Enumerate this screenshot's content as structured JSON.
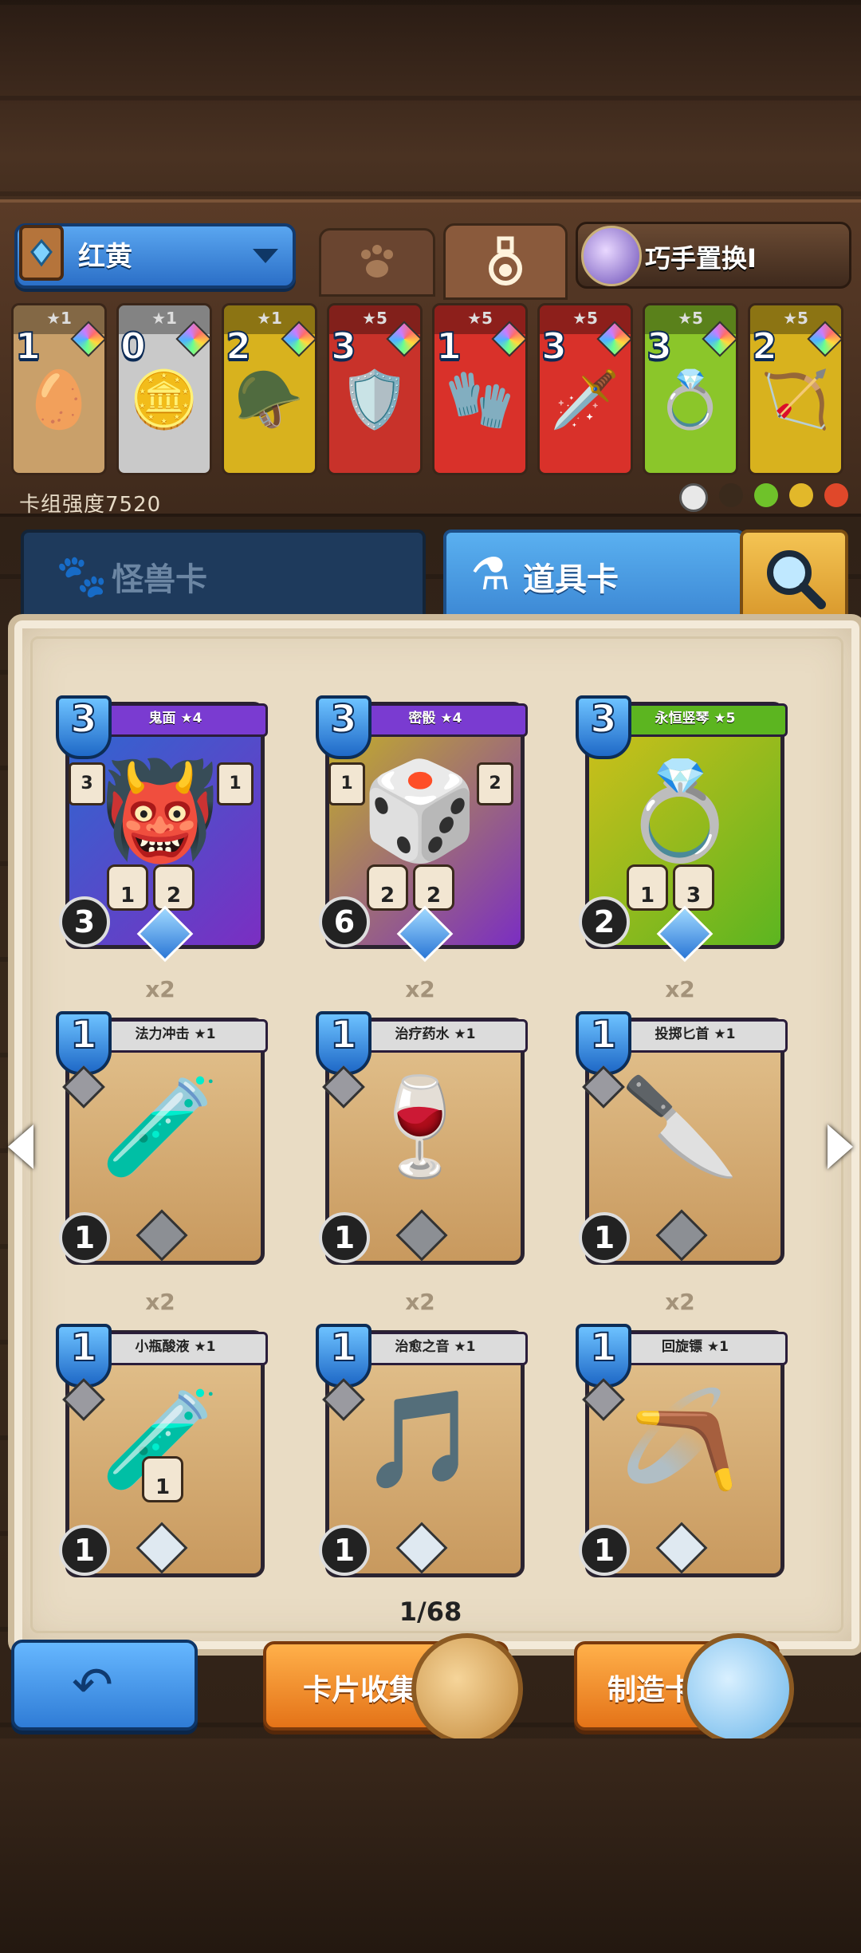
{
  "deck": {
    "name": "红黄",
    "swap_label": "巧手置换I",
    "power_label": "卡组强度7520"
  },
  "mini_cards": [
    {
      "stars": "★1",
      "cost": "1",
      "color": "#c9a06a",
      "art": "🥚"
    },
    {
      "stars": "★1",
      "cost": "0",
      "color": "#c9c9c9",
      "art": "🪙"
    },
    {
      "stars": "★1",
      "cost": "2",
      "color": "#d8b21e",
      "art": "🪖"
    },
    {
      "stars": "★5",
      "cost": "3",
      "color": "#c8322a",
      "art": "🛡️"
    },
    {
      "stars": "★5",
      "cost": "1",
      "color": "#d9312a",
      "art": "🧤"
    },
    {
      "stars": "★5",
      "cost": "3",
      "color": "#d9312a",
      "art": "🗡️"
    },
    {
      "stars": "★5",
      "cost": "3",
      "color": "#8bc62a",
      "art": "💍"
    },
    {
      "stars": "★5",
      "cost": "2",
      "color": "#d8b21e",
      "art": "🏹"
    }
  ],
  "tabs": {
    "monster": "怪兽卡",
    "item": "道具卡"
  },
  "cards_row1": [
    {
      "name": "鬼面 ★4",
      "cost": "3",
      "left": "3",
      "right": "1",
      "b1": "1",
      "b2": "2",
      "power": "3",
      "bg": "linear-gradient(135deg,#2a6ad1,#7b2ec2)",
      "banner": "#7a3bd1",
      "art": "👹"
    },
    {
      "name": "密骰 ★4",
      "cost": "3",
      "left": "1",
      "right": "2",
      "b1": "2",
      "b2": "2",
      "power": "6",
      "bg": "linear-gradient(135deg,#c8b71e,#7b2ec2)",
      "banner": "#7a3bd1",
      "art": "🎲"
    },
    {
      "name": "永恒竖琴 ★5",
      "cost": "3",
      "left": "",
      "right": "",
      "b1": "1",
      "b2": "3",
      "power": "2",
      "bg": "linear-gradient(135deg,#d4c01a,#5cb520)",
      "banner": "#5cb520",
      "art": "💍"
    }
  ],
  "cards_row2": [
    {
      "name": "法力冲击 ★1",
      "count": "x2",
      "cost": "1",
      "power": "1",
      "art": "🧪"
    },
    {
      "name": "治疗药水 ★1",
      "count": "x2",
      "cost": "1",
      "power": "1",
      "art": "🍷"
    },
    {
      "name": "投掷匕首 ★1",
      "count": "x2",
      "cost": "1",
      "power": "1",
      "art": "🔪"
    }
  ],
  "cards_row3": [
    {
      "name": "小瓶酸液 ★1",
      "count": "x2",
      "cost": "1",
      "power": "1",
      "badge": "1",
      "art": "🧪"
    },
    {
      "name": "治愈之音 ★1",
      "count": "x2",
      "cost": "1",
      "power": "1",
      "art": "🎵"
    },
    {
      "name": "回旋镖 ★1",
      "count": "x2",
      "cost": "1",
      "power": "1",
      "art": "🪃"
    }
  ],
  "page": "1/68",
  "buttons": {
    "collect": "卡片收集",
    "craft": "制造卡片"
  }
}
